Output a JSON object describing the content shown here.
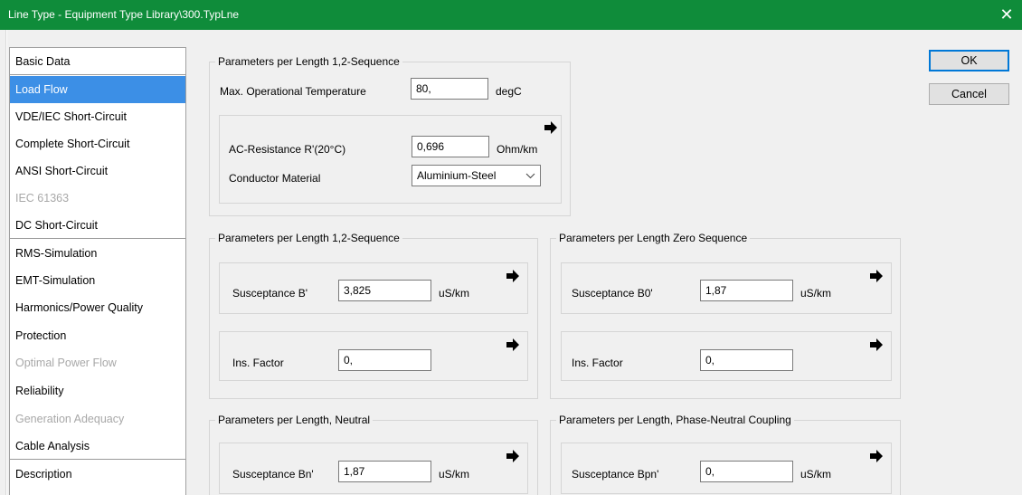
{
  "window": {
    "title": "Line Type - Equipment Type Library\\300.TypLne",
    "close_glyph": "✕"
  },
  "nav": {
    "items": [
      {
        "label": "Basic Data"
      },
      {
        "label": "Load Flow"
      },
      {
        "label": "VDE/IEC Short-Circuit"
      },
      {
        "label": "Complete Short-Circuit"
      },
      {
        "label": "ANSI Short-Circuit"
      },
      {
        "label": "IEC 61363"
      },
      {
        "label": "DC Short-Circuit"
      },
      {
        "label": "RMS-Simulation"
      },
      {
        "label": "EMT-Simulation"
      },
      {
        "label": "Harmonics/Power Quality"
      },
      {
        "label": "Protection"
      },
      {
        "label": "Optimal Power Flow"
      },
      {
        "label": "Reliability"
      },
      {
        "label": "Generation Adequacy"
      },
      {
        "label": "Cable Analysis"
      },
      {
        "label": "Description"
      }
    ],
    "selected": "Load Flow"
  },
  "buttons": {
    "ok": "OK",
    "cancel": "Cancel"
  },
  "group_top": {
    "title": "Parameters per Length 1,2-Sequence",
    "max_temp_label": "Max. Operational Temperature",
    "max_temp_value": "80,",
    "max_temp_unit": "degC",
    "ac_res_label": "AC-Resistance R'(20°C)",
    "ac_res_value": "0,696",
    "ac_res_unit": "Ohm/km",
    "conductor_label": "Conductor Material",
    "conductor_value": "Aluminium-Steel"
  },
  "group_pos": {
    "title": "Parameters per Length 1,2-Sequence",
    "susceptance_label": "Susceptance B'",
    "susceptance_value": "3,825",
    "susceptance_unit": "uS/km",
    "ins_label": "Ins. Factor",
    "ins_value": "0,"
  },
  "group_zero": {
    "title": "Parameters per Length Zero Sequence",
    "susceptance_label": "Susceptance B0'",
    "susceptance_value": "1,87",
    "susceptance_unit": "uS/km",
    "ins_label": "Ins. Factor",
    "ins_value": "0,"
  },
  "group_neutral": {
    "title": "Parameters per Length, Neutral",
    "susceptance_label": "Susceptance Bn'",
    "susceptance_value": "1,87",
    "susceptance_unit": "uS/km"
  },
  "group_coupling": {
    "title": "Parameters per Length, Phase-Neutral Coupling",
    "susceptance_label": "Susceptance Bpn'",
    "susceptance_value": "0,",
    "susceptance_unit": "uS/km"
  }
}
